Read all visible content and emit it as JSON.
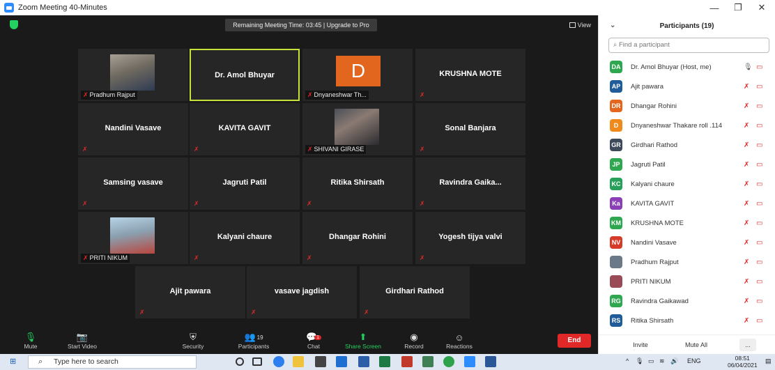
{
  "window": {
    "title": "Zoom Meeting 40-Minutes",
    "minimize": "—",
    "maximize": "❐",
    "close": "✕"
  },
  "meeting": {
    "remaining_banner": "Remaining Meeting Time: 03:45 | Upgrade to Pro",
    "view_label": "View"
  },
  "tiles": {
    "pradhum": "Pradhum Rajput",
    "amol": "Dr. Amol Bhuyar",
    "dnyaneshwar_letter": "D",
    "dnyaneshwar": "Dnyaneshwar Th...",
    "krushna": "KRUSHNA MOTE",
    "nandini": "Nandini Vasave",
    "kavita": "KAVITA GAVIT",
    "shivani": "SHIVANI GIRASE",
    "sonal": "Sonal Banjara",
    "samsing": "Samsing vasave",
    "jagruti": "Jagruti Patil",
    "ritika": "Ritika Shirsath",
    "ravindra": "Ravindra  Gaika...",
    "priti": "PRITI NIKUM",
    "kalyani": "Kalyani chaure",
    "dhangar": "Dhangar Rohini",
    "yogesh": "Yogesh tijya valvi",
    "ajit": "Ajit pawara",
    "vasave": "vasave jagdish",
    "girdhari": "Girdhari Rathod"
  },
  "toolbar": {
    "mute": "Mute",
    "start_video": "Start Video",
    "security": "Security",
    "participants": "Participants",
    "participants_count": "19",
    "chat": "Chat",
    "chat_badge": "1",
    "share_screen": "Share Screen",
    "record": "Record",
    "reactions": "Reactions",
    "end": "End"
  },
  "panel": {
    "title": "Participants (19)",
    "search_placeholder": "Find a participant",
    "participants": [
      {
        "initials": "DA",
        "name": "Dr. Amol Bhuyar (Host, me)",
        "color": "#2ea84f"
      },
      {
        "initials": "AP",
        "name": "Ajit pawara",
        "color": "#1f5c99"
      },
      {
        "initials": "DR",
        "name": "Dhangar Rohini",
        "color": "#e3661f"
      },
      {
        "initials": "D",
        "name": "Dnyaneshwar Thakare roll .114",
        "color": "#f08a1c"
      },
      {
        "initials": "GR",
        "name": "Girdhari Rathod",
        "color": "#3c4a5c"
      },
      {
        "initials": "JP",
        "name": "Jagruti Patil",
        "color": "#2ea84f"
      },
      {
        "initials": "KC",
        "name": "Kalyani chaure",
        "color": "#27a05a"
      },
      {
        "initials": "Ka",
        "name": "KAVITA GAVIT",
        "color": "#8a3fb8"
      },
      {
        "initials": "KM",
        "name": "KRUSHNA MOTE",
        "color": "#2ea84f"
      },
      {
        "initials": "NV",
        "name": "Nandini Vasave",
        "color": "#d63b2a"
      },
      {
        "initials": "",
        "name": "Pradhum Rajput",
        "color": "#6b7a88"
      },
      {
        "initials": "",
        "name": "PRITI NIKUM",
        "color": "#9b4b55"
      },
      {
        "initials": "RG",
        "name": "Ravindra Gaikawad",
        "color": "#2ea84f"
      },
      {
        "initials": "RS",
        "name": "Ritika Shirsath",
        "color": "#1f5c99"
      }
    ],
    "invite": "Invite",
    "mute_all": "Mute All",
    "more": "..."
  },
  "taskbar": {
    "search_placeholder": "Type here to search",
    "language": "ENG",
    "time": "08:51",
    "date": "06/04/2021"
  }
}
